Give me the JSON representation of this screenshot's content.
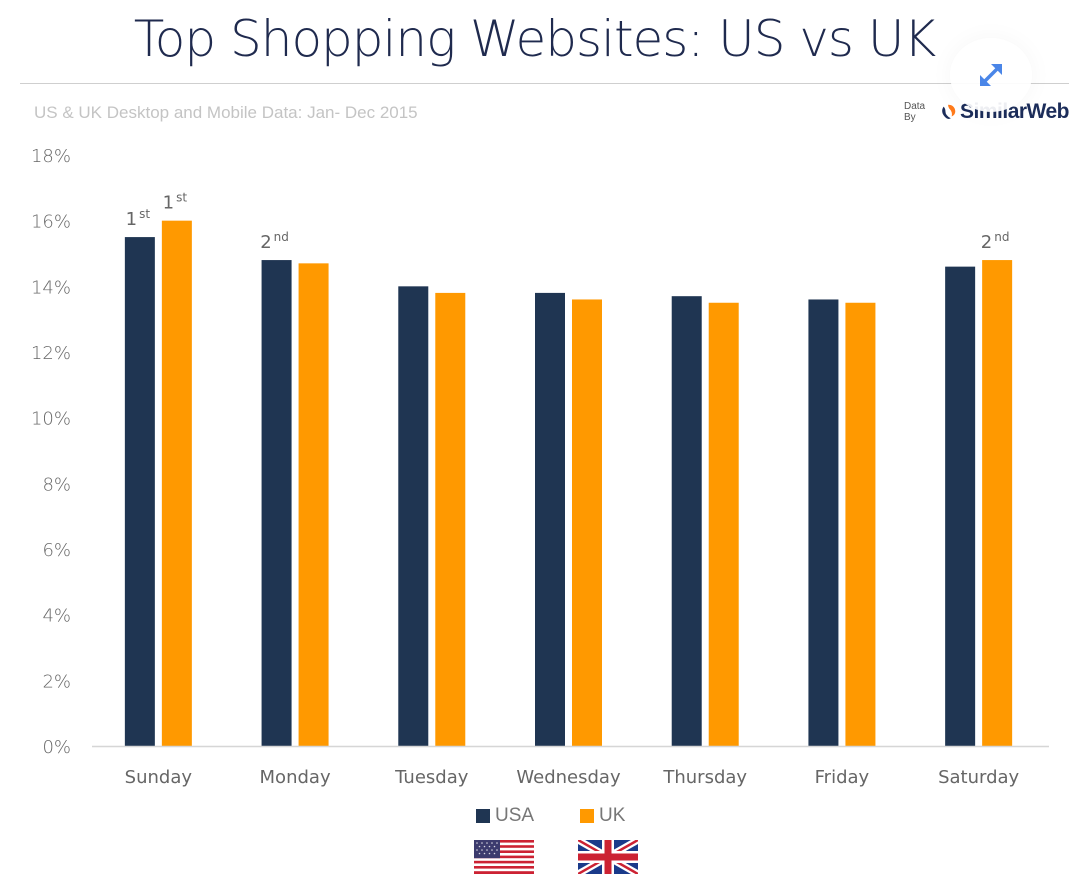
{
  "header": {
    "title": "Top Shopping Websites: US vs UK",
    "subtitle": "US & UK Desktop and Mobile Data: Jan- Dec 2015",
    "credit_prefix": "Data By",
    "credit_brand": "SimilarWeb",
    "expand_icon": "expand-arrows-icon"
  },
  "colors": {
    "usa": "#1f3552",
    "uk": "#ff9900",
    "axis": "#d6d6d6",
    "title": "#1f2a4e",
    "expand_icon": "#4a86e8"
  },
  "chart_data": {
    "type": "bar",
    "title": "Top Shopping Websites: US vs UK",
    "subtitle": "US & UK Desktop and Mobile Data: Jan- Dec 2015",
    "xlabel": "",
    "ylabel": "",
    "ylim": [
      0,
      18
    ],
    "yticks": [
      0,
      2,
      4,
      6,
      8,
      10,
      12,
      14,
      16,
      18
    ],
    "ytick_labels": [
      "0%",
      "2%",
      "4%",
      "6%",
      "8%",
      "10%",
      "12%",
      "14%",
      "16%",
      "18%"
    ],
    "grid": false,
    "legend_position": "bottom-center",
    "categories": [
      "Sunday",
      "Monday",
      "Tuesday",
      "Wednesday",
      "Thursday",
      "Friday",
      "Saturday"
    ],
    "series": [
      {
        "name": "USA",
        "color": "#1f3552",
        "values": [
          15.5,
          14.8,
          14.0,
          13.8,
          13.7,
          13.6,
          14.6
        ]
      },
      {
        "name": "UK",
        "color": "#ff9900",
        "values": [
          16.0,
          14.7,
          13.8,
          13.6,
          13.5,
          13.5,
          14.8
        ]
      }
    ],
    "annotations": [
      {
        "series": "USA",
        "category": "Sunday",
        "rank": "1",
        "suffix": "st"
      },
      {
        "series": "UK",
        "category": "Sunday",
        "rank": "1",
        "suffix": "st"
      },
      {
        "series": "USA",
        "category": "Monday",
        "rank": "2",
        "suffix": "nd"
      },
      {
        "series": "UK",
        "category": "Saturday",
        "rank": "2",
        "suffix": "nd"
      }
    ]
  },
  "legend": {
    "items": [
      {
        "label": "USA",
        "flag": "us-flag-icon"
      },
      {
        "label": "UK",
        "flag": "uk-flag-icon"
      }
    ]
  }
}
